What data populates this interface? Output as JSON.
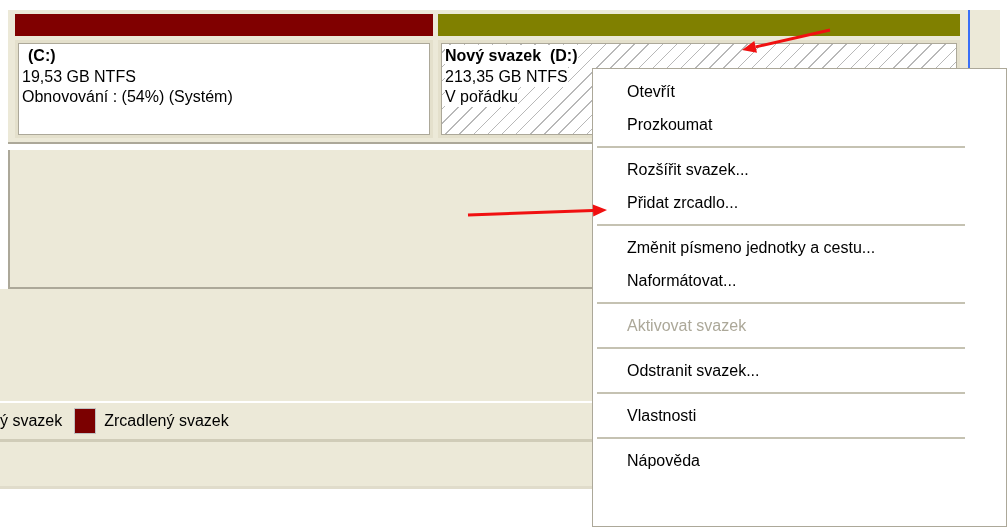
{
  "volumes": [
    {
      "title": "(C:)",
      "size": "19,53 GB NTFS",
      "status": "Obnovování : (54%) (Systém)",
      "color": "#800000",
      "selected": false
    },
    {
      "title": "Nový svazek  (D:)",
      "size": "213,35 GB NTFS",
      "status": "V pořádku",
      "color": "#808000",
      "selected": true
    }
  ],
  "legend": [
    {
      "label": "ý svazek"
    },
    {
      "label": "Zrcadlený svazek",
      "color": "#7b0000"
    }
  ],
  "context_menu": {
    "groups": [
      [
        {
          "label": "Otevřít",
          "disabled": false
        },
        {
          "label": "Prozkoumat",
          "disabled": false
        }
      ],
      [
        {
          "label": "Rozšířit svazek...",
          "disabled": false
        },
        {
          "label": "Přidat zrcadlo...",
          "disabled": false
        }
      ],
      [
        {
          "label": "Změnit písmeno jednotky a cestu...",
          "disabled": false
        },
        {
          "label": "Naformátovat...",
          "disabled": false
        }
      ],
      [
        {
          "label": "Aktivovat svazek",
          "disabled": true
        }
      ],
      [
        {
          "label": "Odstranit svazek...",
          "disabled": false
        }
      ],
      [
        {
          "label": "Vlastnosti",
          "disabled": false
        }
      ],
      [
        {
          "label": "Nápověda",
          "disabled": false
        }
      ]
    ]
  },
  "annotations": [
    {
      "kind": "arrow"
    },
    {
      "kind": "arrow"
    }
  ]
}
